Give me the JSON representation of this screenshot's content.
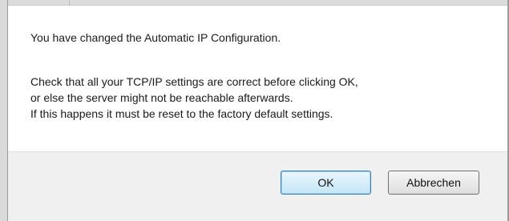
{
  "dialog": {
    "message_line_1": "You have changed the Automatic IP Configuration.",
    "message_line_2": "Check that all your TCP/IP settings are correct before clicking OK,",
    "message_line_3": "or else the server might not be reachable afterwards.",
    "message_line_4": "If this happens it must be reset to the factory default settings.",
    "ok_label": "OK",
    "cancel_label": "Abbrechen"
  },
  "colors": {
    "content_bg": "#ffffff",
    "footer_bg": "#f0f0f0",
    "default_button_border": "#3c7fb1"
  }
}
